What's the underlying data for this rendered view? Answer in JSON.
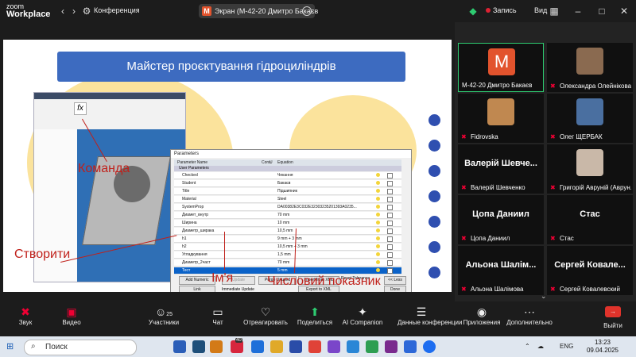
{
  "topbar": {
    "logo_line1": "zoom",
    "logo_line2": "Workplace",
    "meeting_title": "Конференция",
    "screen_share_label": "Экран (М-42-20 Дмитро Бакаєв",
    "record_label": "Запись",
    "view_label": "Вид"
  },
  "slide": {
    "title": "Майстер проєктування гідроциліндрів",
    "label_command": "Команда",
    "label_create": "Створити",
    "label_name": "Ім'я",
    "label_numeric": "Числовий показник",
    "dialog": {
      "title": "Parameters",
      "col_name": "Parameter Name",
      "col_cons": "Cons",
      "col_unit": "U",
      "col_equation": "Equation",
      "group": "User Parameters",
      "rows": [
        {
          "name": "Checked",
          "eq": "Чекання"
        },
        {
          "name": "Student",
          "eq": "Бакаєв"
        },
        {
          "name": "Title",
          "eq": "Підшипник"
        },
        {
          "name": "Material",
          "eq": "Steel"
        },
        {
          "name": "SystemProp",
          "eq": "DA00382E3C032E32303235201393A0235..."
        },
        {
          "name": "Диамет_внутр",
          "eq": "70 mm"
        },
        {
          "name": "Ширина",
          "eq": "10 mm"
        },
        {
          "name": "Диаметр_ширака",
          "eq": "10,5 mm"
        },
        {
          "name": "h1",
          "eq": "9 mm + 3 mm"
        },
        {
          "name": "h2",
          "eq": "10,5 mm + 3 mm"
        },
        {
          "name": "Угладкування",
          "eq": "1,5 mm"
        },
        {
          "name": "Диаметр_2част",
          "eq": "70 mm"
        },
        {
          "name": "Тест",
          "eq": "5 mm"
        }
      ],
      "btn_add_numeric": "Add Numeric",
      "btn_update": "Update",
      "btn_purge": "Purge Unused",
      "btn_import": "Import from XML",
      "btn_link": "Link",
      "chk_immediate": "Immediate Update",
      "btn_export": "Export to XML",
      "reset_tol": "Reset Tolerance",
      "btn_less": "<< Less",
      "btn_done": "Done"
    }
  },
  "participants": [
    {
      "name": "М-42-20 Дмитро Бакаєв",
      "avatar_letter": "М",
      "color": "#e2532d",
      "active": true
    },
    {
      "name": "Олександра Олейнікова",
      "color": "#8a6a50"
    },
    {
      "name": "Fidrovska",
      "color": "#c08850"
    },
    {
      "name": "Олег ЩЕРБАК",
      "color": "#4a6fa0"
    },
    {
      "name": "Валерій Шевченко",
      "big": "Валерій  Шевче..."
    },
    {
      "name": "Григорій Авруній (Аврун...",
      "color": "#c9b8a8"
    },
    {
      "name": "Цопа Даниил",
      "big": "Цопа Даниил"
    },
    {
      "name": "Стас",
      "big": "Стас"
    },
    {
      "name": "Альона Шалімова",
      "big": "Альона  Шалім..."
    },
    {
      "name": "Сергей Ковалевский",
      "big": "Сергей  Ковале..."
    }
  ],
  "toolbar": {
    "audio": "Звук",
    "video": "Видео",
    "participants": "Участники",
    "participants_count": "25",
    "chat": "Чат",
    "react": "Отреагировать",
    "share": "Поделиться",
    "ai": "AI Companion",
    "data": "Данные конференции",
    "apps": "Приложения",
    "more": "Дополнительно",
    "leave": "Выйти"
  },
  "taskbar": {
    "search": "Поиск",
    "lang": "ENG",
    "time": "13:23",
    "date": "09.04.2025",
    "badge": "40"
  }
}
